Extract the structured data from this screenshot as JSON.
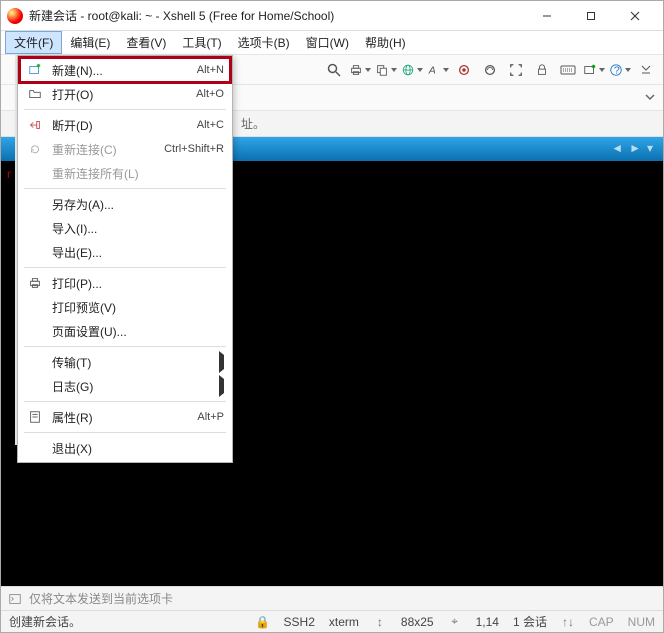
{
  "title": "新建会话 - root@kali: ~ - Xshell 5 (Free for Home/School)",
  "menubar": {
    "file": "文件(F)",
    "edit": "编辑(E)",
    "view": "查看(V)",
    "tools": "工具(T)",
    "tabs": "选项卡(B)",
    "window": "窗口(W)",
    "help": "帮助(H)"
  },
  "file_menu": {
    "new": {
      "label": "新建(N)...",
      "shortcut": "Alt+N"
    },
    "open": {
      "label": "打开(O)",
      "shortcut": "Alt+O"
    },
    "disconnect": {
      "label": "断开(D)",
      "shortcut": "Alt+C"
    },
    "reconnect": {
      "label": "重新连接(C)",
      "shortcut": "Ctrl+Shift+R"
    },
    "reconnect_all": {
      "label": "重新连接所有(L)"
    },
    "save_as": {
      "label": "另存为(A)..."
    },
    "import": {
      "label": "导入(I)..."
    },
    "export": {
      "label": "导出(E)..."
    },
    "print": {
      "label": "打印(P)..."
    },
    "print_preview": {
      "label": "打印预览(V)"
    },
    "page_setup": {
      "label": "页面设置(U)..."
    },
    "transfer": {
      "label": "传输(T)"
    },
    "log": {
      "label": "日志(G)"
    },
    "properties": {
      "label": "属性(R)",
      "shortcut": "Alt+P"
    },
    "exit": {
      "label": "退出(X)"
    }
  },
  "hint_partial": "址。",
  "commandbar_placeholder": "仅将文本发送到当前选项卡",
  "status": {
    "text": "创建新会话。",
    "ssh": "SSH2",
    "term": "xterm",
    "rowcols": "88x25",
    "pos": "1,14",
    "sessions": "1 会话",
    "cap": "CAP",
    "num": "NUM"
  },
  "icons": {
    "search": "search-icon",
    "print": "print-icon",
    "copy": "copy-icon",
    "globe": "globe-icon",
    "font": "font-icon",
    "coffee": "coffee-icon",
    "eye": "eye-icon",
    "fullscreen": "fullscreen-icon",
    "lock": "lock-icon",
    "keyboard": "keyboard-icon",
    "addtab": "addtab-icon",
    "help": "help-icon",
    "new": "newsession-icon",
    "open": "folder-open-icon",
    "disconnect": "disconnect-icon",
    "reconnect": "reconnect-icon",
    "properties": "properties-icon",
    "cmd": "terminal-icon",
    "conn": "connection-icon",
    "size": "resize-icon",
    "cursor": "cursor-icon",
    "signal": "signal-icon"
  }
}
